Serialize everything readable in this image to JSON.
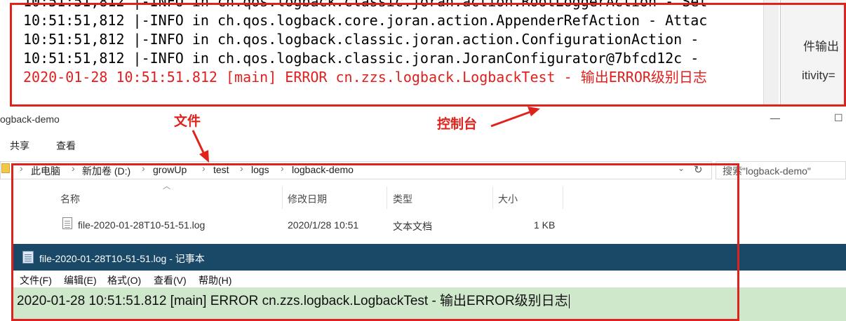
{
  "console": {
    "lines": [
      "10:51:51,812 |-INFO in ch.qos.logback.classic.joran.action.RootLoggerAction - Set",
      "10:51:51,812 |-INFO in ch.qos.logback.core.joran.action.AppenderRefAction - Attac",
      "10:51:51,812 |-INFO in ch.qos.logback.classic.joran.action.ConfigurationAction -",
      "10:51:51,812 |-INFO in ch.qos.logback.classic.joran.JoranConfigurator@7bfcd12c -"
    ],
    "error_line": "2020-01-28 10:51:51.812 [main] ERROR cn.zzs.logback.LogbackTest - 输出ERROR级别日志",
    "error_color": "#e0201e"
  },
  "right_panel": {
    "text_1": "件输出",
    "text_2": "itivity="
  },
  "explorer": {
    "title": "ogback-demo",
    "ribbon": [
      "共享",
      "查看"
    ],
    "breadcrumb": [
      "此电脑",
      "新加卷 (D:)",
      "growUp",
      "test",
      "logs",
      "logback-demo"
    ],
    "search_placeholder": "搜索\"logback-demo\"",
    "columns": [
      "名称",
      "修改日期",
      "类型",
      "大小"
    ],
    "file": {
      "name": "file-2020-01-28T10-51-51.log",
      "modified": "2020/1/28 10:51",
      "type": "文本文档",
      "size": "1 KB"
    },
    "window_buttons": [
      "—",
      "☐"
    ]
  },
  "notepad": {
    "title": "file-2020-01-28T10-51-51.log - 记事本",
    "menus": [
      "文件(F)",
      "编辑(E)",
      "格式(O)",
      "查看(V)",
      "帮助(H)"
    ],
    "content": "2020-01-28 10:51:51.812 [main] ERROR cn.zzs.logback.LogbackTest - 输出ERROR级别日志"
  },
  "annotations": {
    "file_label": "文件",
    "console_label": "控制台",
    "color": "#e0221c"
  }
}
